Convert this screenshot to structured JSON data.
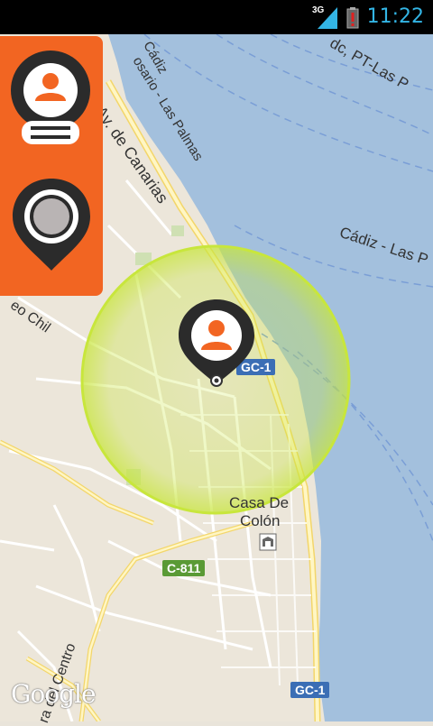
{
  "status_bar": {
    "time": "11:22",
    "network": "3G",
    "icons": [
      "signal-icon",
      "battery-alert-icon"
    ]
  },
  "map": {
    "labels": {
      "cadiz_top": "Cádiz",
      "rosario": "osario - Las Palmas",
      "pt_las": "dc, PT-Las P",
      "cadiz_las": "Cádiz - Las P",
      "av_canarias": "Av. de Canarias",
      "chil": "eo Chil",
      "casa": "Casa De",
      "colon": "Colón",
      "centro": "ra del Centro"
    },
    "road_badges": {
      "gc1_top": "GC-1",
      "c811": "C-811",
      "gc1_bottom": "GC-1"
    },
    "attribution": "Google",
    "colors": {
      "water": "#a3c0dd",
      "land": "#ece6da",
      "road": "#fff6c4",
      "radius": "#c8e63c",
      "accent": "#f26522",
      "marker": "#2b2b2b"
    }
  },
  "sidepanel": {
    "buttons": [
      "user-list-button",
      "location-pin-button"
    ]
  }
}
